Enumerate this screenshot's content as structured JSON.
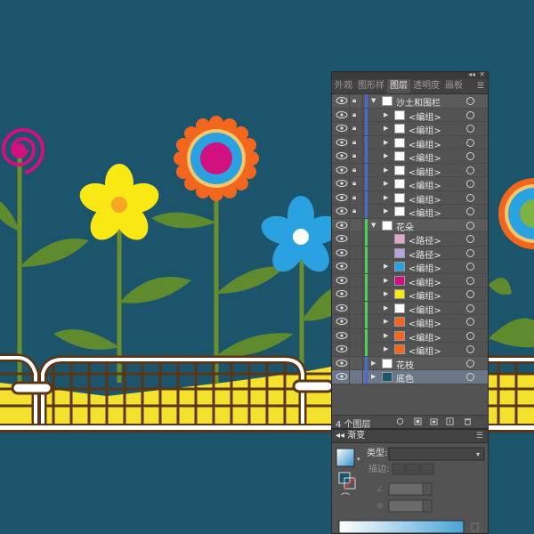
{
  "layers_panel": {
    "tabs": [
      {
        "label": "外观"
      },
      {
        "label": "图形样"
      },
      {
        "label": "图层"
      },
      {
        "label": "透明度"
      },
      {
        "label": "画板"
      }
    ],
    "rows": [
      {
        "name": "沙土和围栏",
        "level": 0,
        "expanded": true,
        "locked": true,
        "bar": "#4e68d6",
        "thumb": "fence"
      },
      {
        "name": "<编组>",
        "level": 1,
        "locked": true,
        "bar": "#4e68d6",
        "thumb": "stripes"
      },
      {
        "name": "<编组>",
        "level": 1,
        "locked": true,
        "bar": "#4e68d6",
        "thumb": "stripes"
      },
      {
        "name": "<编组>",
        "level": 1,
        "locked": true,
        "bar": "#4e68d6",
        "thumb": "stripes"
      },
      {
        "name": "<编组>",
        "level": 1,
        "locked": true,
        "bar": "#4e68d6",
        "thumb": "stripes"
      },
      {
        "name": "<编组>",
        "level": 1,
        "locked": true,
        "bar": "#4e68d6",
        "thumb": "stripes"
      },
      {
        "name": "<编组>",
        "level": 1,
        "locked": true,
        "bar": "#4e68d6",
        "thumb": "stripes"
      },
      {
        "name": "<编组>",
        "level": 1,
        "locked": true,
        "bar": "#4e68d6",
        "thumb": "stripes"
      },
      {
        "name": "<编组>",
        "level": 1,
        "locked": true,
        "bar": "#4e68d6",
        "thumb": "stripes"
      },
      {
        "name": "花朵",
        "level": 0,
        "expanded": true,
        "locked": false,
        "bar": "#4fd25a",
        "thumb": "flower"
      },
      {
        "name": "<路径>",
        "level": 1,
        "locked": false,
        "bar": "#4fd25a",
        "thumb": "pink-ring"
      },
      {
        "name": "<路径>",
        "level": 1,
        "locked": false,
        "bar": "#4fd25a",
        "thumb": "violet-ring"
      },
      {
        "name": "<编组>",
        "level": 1,
        "locked": false,
        "bar": "#4fd25a",
        "thumb": "blue"
      },
      {
        "name": "<编组>",
        "level": 1,
        "locked": false,
        "bar": "#4fd25a",
        "thumb": "magenta"
      },
      {
        "name": "<编组>",
        "level": 1,
        "locked": false,
        "bar": "#4fd25a",
        "thumb": "yellow"
      },
      {
        "name": "<编组>",
        "level": 1,
        "locked": false,
        "bar": "#4fd25a",
        "thumb": "blank"
      },
      {
        "name": "<编组>",
        "level": 1,
        "locked": false,
        "bar": "#4fd25a",
        "thumb": "orange"
      },
      {
        "name": "<编组>",
        "level": 1,
        "locked": false,
        "bar": "#4fd25a",
        "thumb": "orange2"
      },
      {
        "name": "<编组>",
        "level": 1,
        "locked": false,
        "bar": "#4fd25a",
        "thumb": "orange3"
      },
      {
        "name": "花枝",
        "level": 0,
        "expanded": false,
        "locked": false,
        "bar": "#4e68d6",
        "thumb": "stem"
      },
      {
        "name": "底色",
        "level": 0,
        "expanded": false,
        "locked": false,
        "bar": "#4e68d6",
        "thumb": "bg",
        "selected": true
      }
    ],
    "layer_count_label": "4 个图层"
  },
  "gradient_panel": {
    "title": "渐变",
    "type_label": "类型:",
    "stroke_label": "描边:"
  },
  "colors": {
    "background": "#1b546b",
    "fence": "#5b3514",
    "sand": "#f3e12e",
    "stem": "#6b8e2e",
    "leaf": "#5f8a2e",
    "flower_yellow": "#f9e814",
    "flower_blue": "#2aa1e0",
    "flower_orange": "#f2661d",
    "flower_magenta": "#d2107f"
  }
}
